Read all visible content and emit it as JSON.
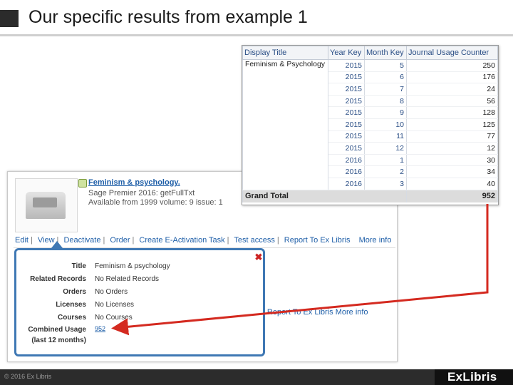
{
  "slide": {
    "title": "Our specific results from example 1",
    "copyright": "© 2016 Ex Libris",
    "logo_text": "ExLibris"
  },
  "record": {
    "title_link": "Feminism & psychology.",
    "lines": [
      "Sage Premier 2016: getFullTxt",
      "Available from 1999 volume: 9 issue: 1"
    ],
    "actions": [
      "Edit",
      "View",
      "Deactivate",
      "Order",
      "Create E-Activation Task",
      "Test access",
      "Report To Ex Libris",
      "More info"
    ],
    "behind_actions": "| Report To Ex Libris   More info"
  },
  "popup": {
    "rows": [
      {
        "label": "Title",
        "value": "Feminism & psychology"
      },
      {
        "label": "Related Records",
        "value": "No Related Records"
      },
      {
        "label": "Orders",
        "value": "No Orders"
      },
      {
        "label": "Licenses",
        "value": "No Licenses"
      },
      {
        "label": "Courses",
        "value": "No Courses"
      }
    ],
    "combined_label_1": "Combined Usage",
    "combined_label_2": "(last 12 months)",
    "combined_value": "952"
  },
  "usage_table": {
    "headers": [
      "Display Title",
      "Year Key",
      "Month Key",
      "Journal Usage Counter"
    ],
    "display_title": "Feminism & Psychology",
    "rows": [
      [
        "2015",
        "5",
        "250"
      ],
      [
        "2015",
        "6",
        "176"
      ],
      [
        "2015",
        "7",
        "24"
      ],
      [
        "2015",
        "8",
        "56"
      ],
      [
        "2015",
        "9",
        "128"
      ],
      [
        "2015",
        "10",
        "125"
      ],
      [
        "2015",
        "11",
        "77"
      ],
      [
        "2015",
        "12",
        "12"
      ],
      [
        "2016",
        "1",
        "30"
      ],
      [
        "2016",
        "2",
        "34"
      ],
      [
        "2016",
        "3",
        "40"
      ]
    ],
    "grand_total_label": "Grand Total",
    "grand_total_value": "952"
  },
  "colors": {
    "arrow": "#d42a20",
    "popup_border": "#3f78b4",
    "link": "#1f5fa8"
  }
}
